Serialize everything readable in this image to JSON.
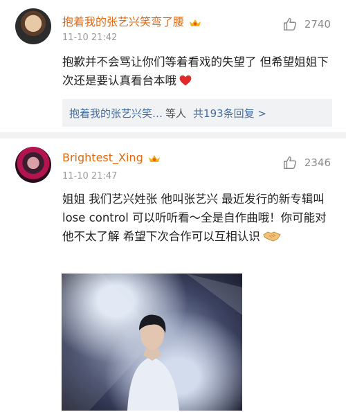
{
  "comments": [
    {
      "username": "抱着我的张艺兴笑弯了腰",
      "time": "11-10 21:42",
      "likes": "2740",
      "text": "抱歉并不会骂让你们等着看戏的失望了 但希望姐姐下次还是要认真看台本哦",
      "emoji": "heart-icon",
      "reply": {
        "names": "抱着我的张艺兴笑…",
        "suffix": "等人",
        "count_text": "共193条回复 >"
      }
    },
    {
      "username": "Brightest_Xing",
      "time": "11-10 21:47",
      "likes": "2346",
      "text": "姐姐 我们艺兴姓张 他叫张艺兴 最近发行的新专辑叫lose control 可以听听看～全是自作曲哦！你可能对他不太了解 希望下次合作可以互相认识",
      "emoji": "handshake-icon"
    }
  ],
  "colors": {
    "username": "#e06a13",
    "link": "#466c9c",
    "meta": "#9a9a9a"
  }
}
